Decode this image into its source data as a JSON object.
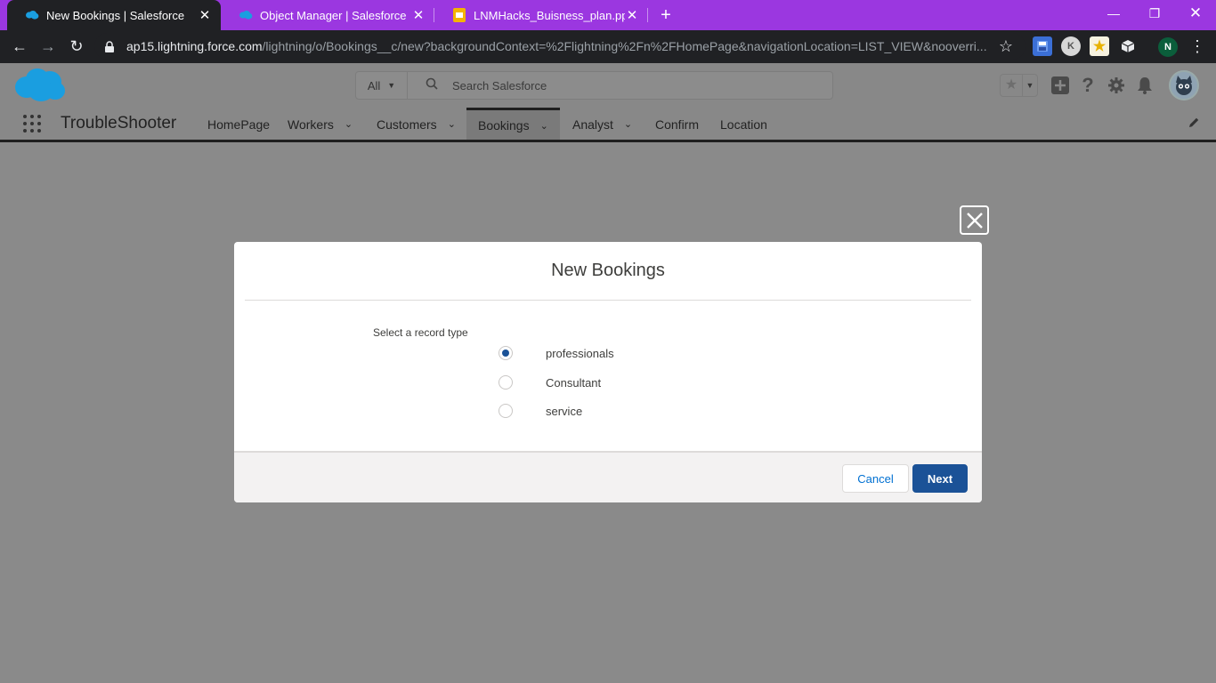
{
  "browser": {
    "tabs": [
      {
        "title": "New Bookings | Salesforce",
        "icon": "salesforce-cloud-icon",
        "active": true
      },
      {
        "title": "Object Manager | Salesforce",
        "icon": "salesforce-cloud-icon",
        "active": false
      },
      {
        "title": "LNMHacks_Buisness_plan.pptx - (",
        "icon": "slides-icon",
        "active": false
      }
    ],
    "new_tab": "+",
    "url_host": "ap15.lightning.force.com",
    "url_path": "/lightning/o/Bookings__c/new?backgroundContext=%2Flightning%2Fn%2FHomePage&navigationLocation=LIST_VIEW&nooverri...",
    "profile_initial": "N",
    "colors": {
      "tab_strip": "#9b37e0",
      "toolbar": "#202124"
    }
  },
  "salesforce": {
    "search": {
      "scope": "All",
      "placeholder": "Search Salesforce"
    },
    "app_name": "TroubleShooter",
    "nav": [
      {
        "label": "HomePage",
        "has_menu": false,
        "active": false
      },
      {
        "label": "Workers",
        "has_menu": true,
        "active": false
      },
      {
        "label": "Customers",
        "has_menu": true,
        "active": false
      },
      {
        "label": "Bookings",
        "has_menu": true,
        "active": true
      },
      {
        "label": "Analyst",
        "has_menu": true,
        "active": false
      },
      {
        "label": "Confirm",
        "has_menu": false,
        "active": false
      },
      {
        "label": "Location",
        "has_menu": false,
        "active": false
      }
    ]
  },
  "modal": {
    "title": "New Bookings",
    "record_type_label": "Select a record type",
    "options": [
      {
        "label": "professionals",
        "selected": true
      },
      {
        "label": "Consultant",
        "selected": false
      },
      {
        "label": "service",
        "selected": false
      }
    ],
    "cancel_label": "Cancel",
    "next_label": "Next",
    "colors": {
      "primary": "#1b5297",
      "link": "#0070d2"
    }
  }
}
